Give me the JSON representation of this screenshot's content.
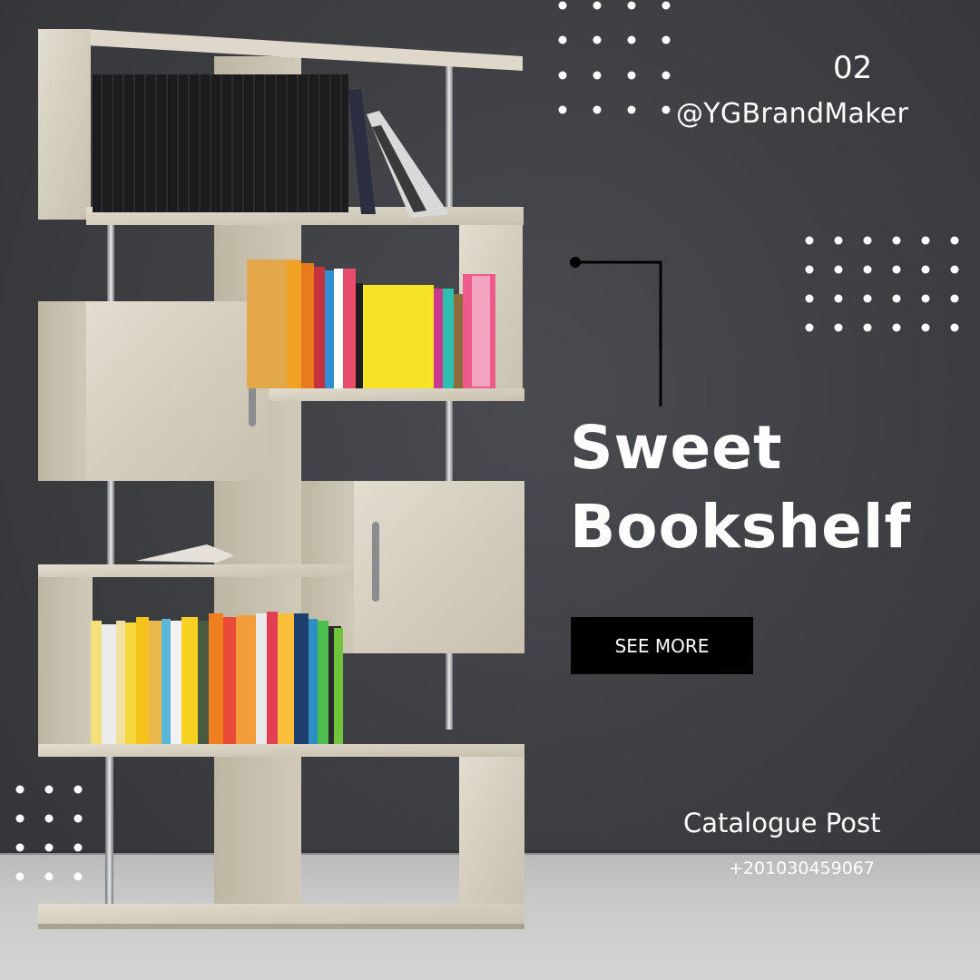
{
  "page_number": "02",
  "handle": "@YGBrandMaker",
  "title": {
    "line1": "Sweet",
    "line2": "Bookshelf"
  },
  "cta": {
    "label": "SEE MORE"
  },
  "footer": {
    "label": "Catalogue Post",
    "phone": "+201030459067"
  },
  "colors": {
    "background": "#3e3f43",
    "text": "#ffffff",
    "button": "#000000",
    "shelf_wood": "#d7d2c3",
    "floor": "#c4c5c4"
  },
  "decor": {
    "dot_grids": 3
  }
}
